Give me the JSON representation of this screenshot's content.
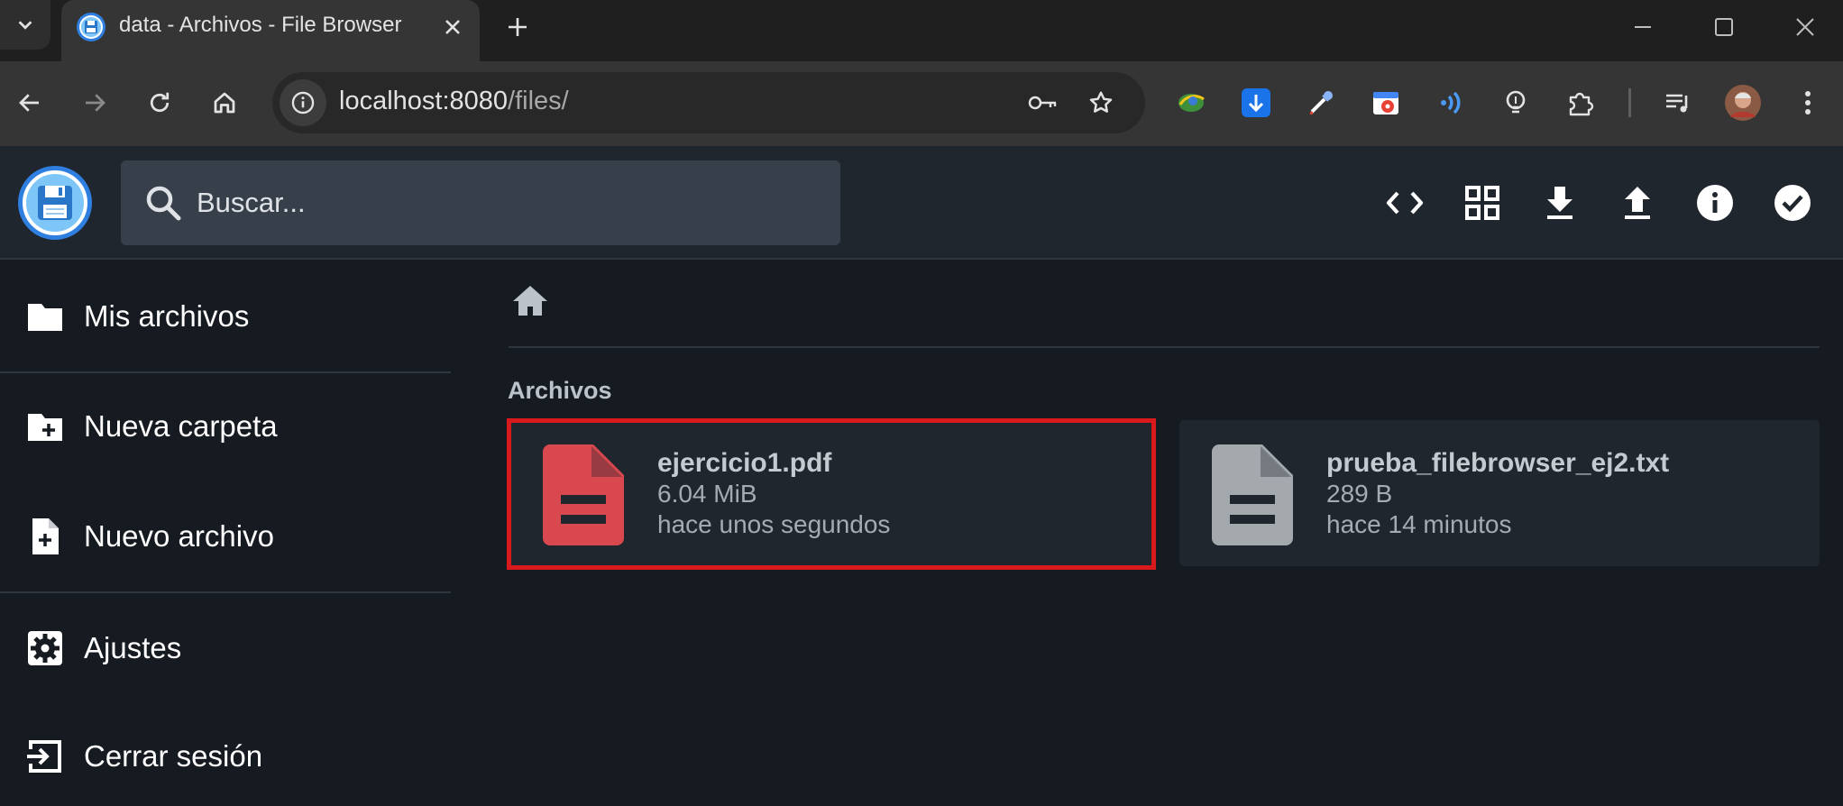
{
  "browser": {
    "tab_title": "data - Archivos - File Browser",
    "url_host": "localhost:8080",
    "url_path": "/files/"
  },
  "search": {
    "placeholder": "Buscar..."
  },
  "sidebar": {
    "items": [
      {
        "label": "Mis archivos",
        "icon": "folder-icon"
      },
      {
        "label": "Nueva carpeta",
        "icon": "new-folder-icon"
      },
      {
        "label": "Nuevo archivo",
        "icon": "new-file-icon"
      },
      {
        "label": "Ajustes",
        "icon": "settings-gear-icon"
      },
      {
        "label": "Cerrar sesión",
        "icon": "logout-icon"
      }
    ]
  },
  "header_actions": [
    "code-view-icon",
    "grid-view-icon",
    "download-icon",
    "upload-icon",
    "info-icon",
    "select-check-icon"
  ],
  "main": {
    "section_title": "Archivos",
    "files": [
      {
        "name": "ejercicio1.pdf",
        "size": "6.04 MiB",
        "modified": "hace unos segundos",
        "type": "pdf",
        "icon_color": "#d9484f",
        "highlighted": true
      },
      {
        "name": "prueba_filebrowser_ej2.txt",
        "size": "289 B",
        "modified": "hace 14 minutos",
        "type": "text",
        "icon_color": "#a4a9ae",
        "highlighted": false
      }
    ]
  },
  "colors": {
    "app_bg": "#161b21",
    "header_bg": "#20262e",
    "highlight_border": "#d9191c",
    "pdf_icon": "#d9484f",
    "text_icon": "#a4a9ae"
  }
}
